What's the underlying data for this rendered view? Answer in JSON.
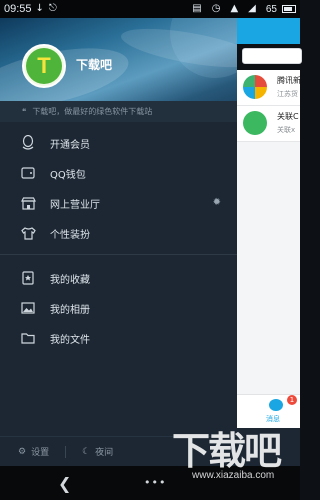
{
  "status_bar": {
    "time": "09:55",
    "battery": "65"
  },
  "drawer": {
    "username": "下载吧",
    "avatar_letter": "T",
    "slogan": "下载吧，做最好的绿色软件下载站",
    "menu": [
      {
        "label": "开通会员",
        "icon": "penguin-icon"
      },
      {
        "label": "QQ钱包",
        "icon": "wallet-icon"
      },
      {
        "label": "网上营业厅",
        "icon": "store-icon"
      },
      {
        "label": "个性装扮",
        "icon": "tshirt-icon"
      },
      {
        "label": "我的收藏",
        "icon": "bookmark-icon"
      },
      {
        "label": "我的相册",
        "icon": "photo-icon"
      },
      {
        "label": "我的文件",
        "icon": "folder-icon"
      }
    ],
    "footer": {
      "settings_label": "设置",
      "night_label": "夜间"
    }
  },
  "main": {
    "chats": [
      {
        "title": "腾讯新",
        "subtitle": "江苏货"
      },
      {
        "title": "关联C",
        "subtitle": "关联x"
      }
    ],
    "tab_label": "消息",
    "tab_badge": "1"
  },
  "watermark": {
    "title": "下载吧",
    "url": "www.xiazaiba.com"
  },
  "colors": {
    "drawer_bg": "#1c2733",
    "accent": "#1aa6e2",
    "badge": "#ee4a3c"
  }
}
